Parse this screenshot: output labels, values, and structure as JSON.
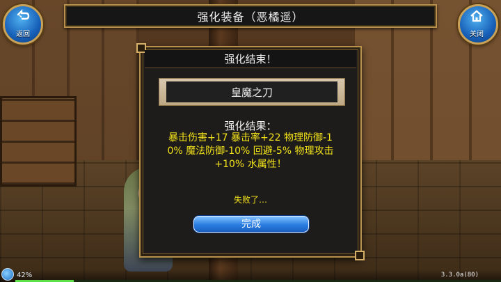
{
  "header": {
    "title": "强化装备（恶橘遥）",
    "back_label": "返回",
    "close_label": "关闭"
  },
  "dialog": {
    "title": "强化结束！",
    "item_name": "皇魔之刀",
    "result_heading": "强化结果：",
    "result_lines": [
      "暴击伤害+17 暴击率+22 物理防御-1",
      "0% 魔法防御-10% 回避-5% 物理攻击",
      "+10% 水属性！"
    ],
    "fail_message": "失败了…",
    "done_label": "完成"
  },
  "status": {
    "battery_percent": "42%",
    "version": "3.3.0a(80)",
    "progress_fraction": 0.12
  },
  "colors": {
    "accent_gold": "#b8924c",
    "result_yellow": "#f2e21a",
    "button_blue": "#2a7ce0"
  },
  "icons": {
    "back": "back-arrow-icon",
    "close": "home-icon"
  }
}
